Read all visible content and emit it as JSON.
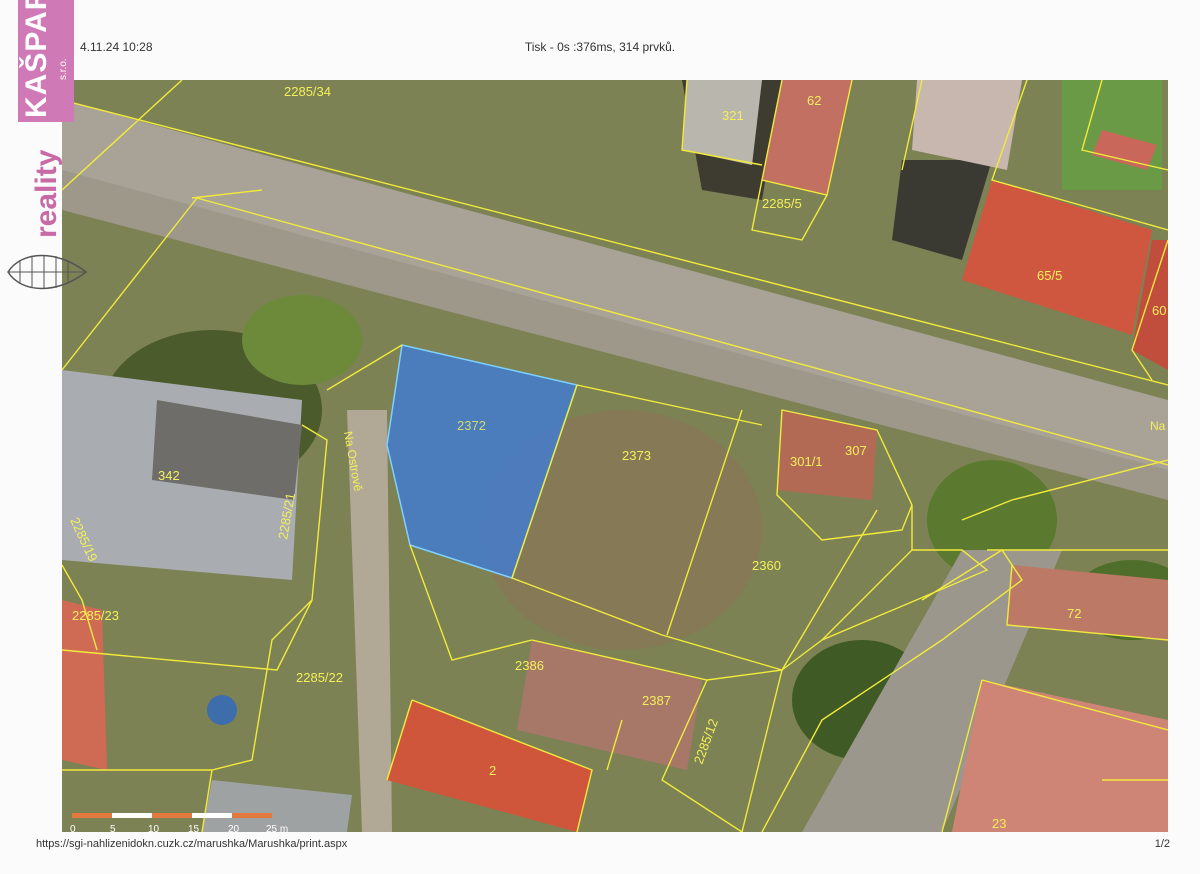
{
  "header": {
    "datetime": "4.11.24 10:28",
    "print_info": "Tisk - 0s :376ms, 314 prvků."
  },
  "footer": {
    "url": "https://sgi-nahlizenidokn.cuzk.cz/marushka/Marushka/print.aspx",
    "page": "1/2"
  },
  "logo": {
    "brand": "KAŠPAR",
    "suffix": "s.r.o.",
    "word": "reality",
    "color": "#c86aa6"
  },
  "map": {
    "highlighted_parcel": "2372",
    "highlight_color": "#3d7bd8",
    "boundary_color": "#f1ea3c",
    "parcels": [
      "2285/34",
      "321",
      "62",
      "2285/5",
      "65/5",
      "60",
      "2372",
      "2373",
      "301/1",
      "307",
      "342",
      "2285/21",
      "2285/19",
      "2285/23",
      "2360",
      "72",
      "2386",
      "2387",
      "2285/22",
      "2285/12",
      "2",
      "23"
    ],
    "street": "Na Ostrově",
    "street_right": "Na",
    "scale_ticks": [
      "0",
      "5",
      "10",
      "15",
      "20",
      "25 m"
    ]
  }
}
